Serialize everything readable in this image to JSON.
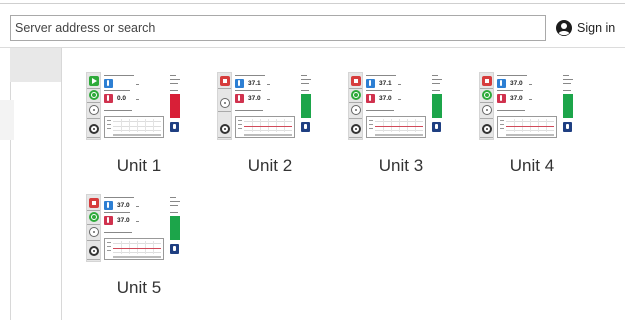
{
  "header": {
    "search": {
      "placeholder": "Server address or search",
      "value": ""
    },
    "signin_label": "Sign in"
  },
  "units": [
    {
      "name": "Unit 1",
      "control": "play",
      "current_temp": "",
      "set_temp": "0.0",
      "status_color": "#d81f37"
    },
    {
      "name": "Unit 2",
      "control": "stop",
      "current_temp": "37.1",
      "set_temp": "37.0",
      "status_color": "#1ca54a"
    },
    {
      "name": "Unit 3",
      "control": "stop",
      "current_temp": "37.1",
      "set_temp": "37.0",
      "status_color": "#1ca54a"
    },
    {
      "name": "Unit 4",
      "control": "stop",
      "current_temp": "37.0",
      "set_temp": "37.0",
      "status_color": "#1ca54a"
    },
    {
      "name": "Unit 5",
      "control": "stop",
      "current_temp": "37.0",
      "set_temp": "37.0",
      "status_color": "#1ca54a"
    }
  ]
}
